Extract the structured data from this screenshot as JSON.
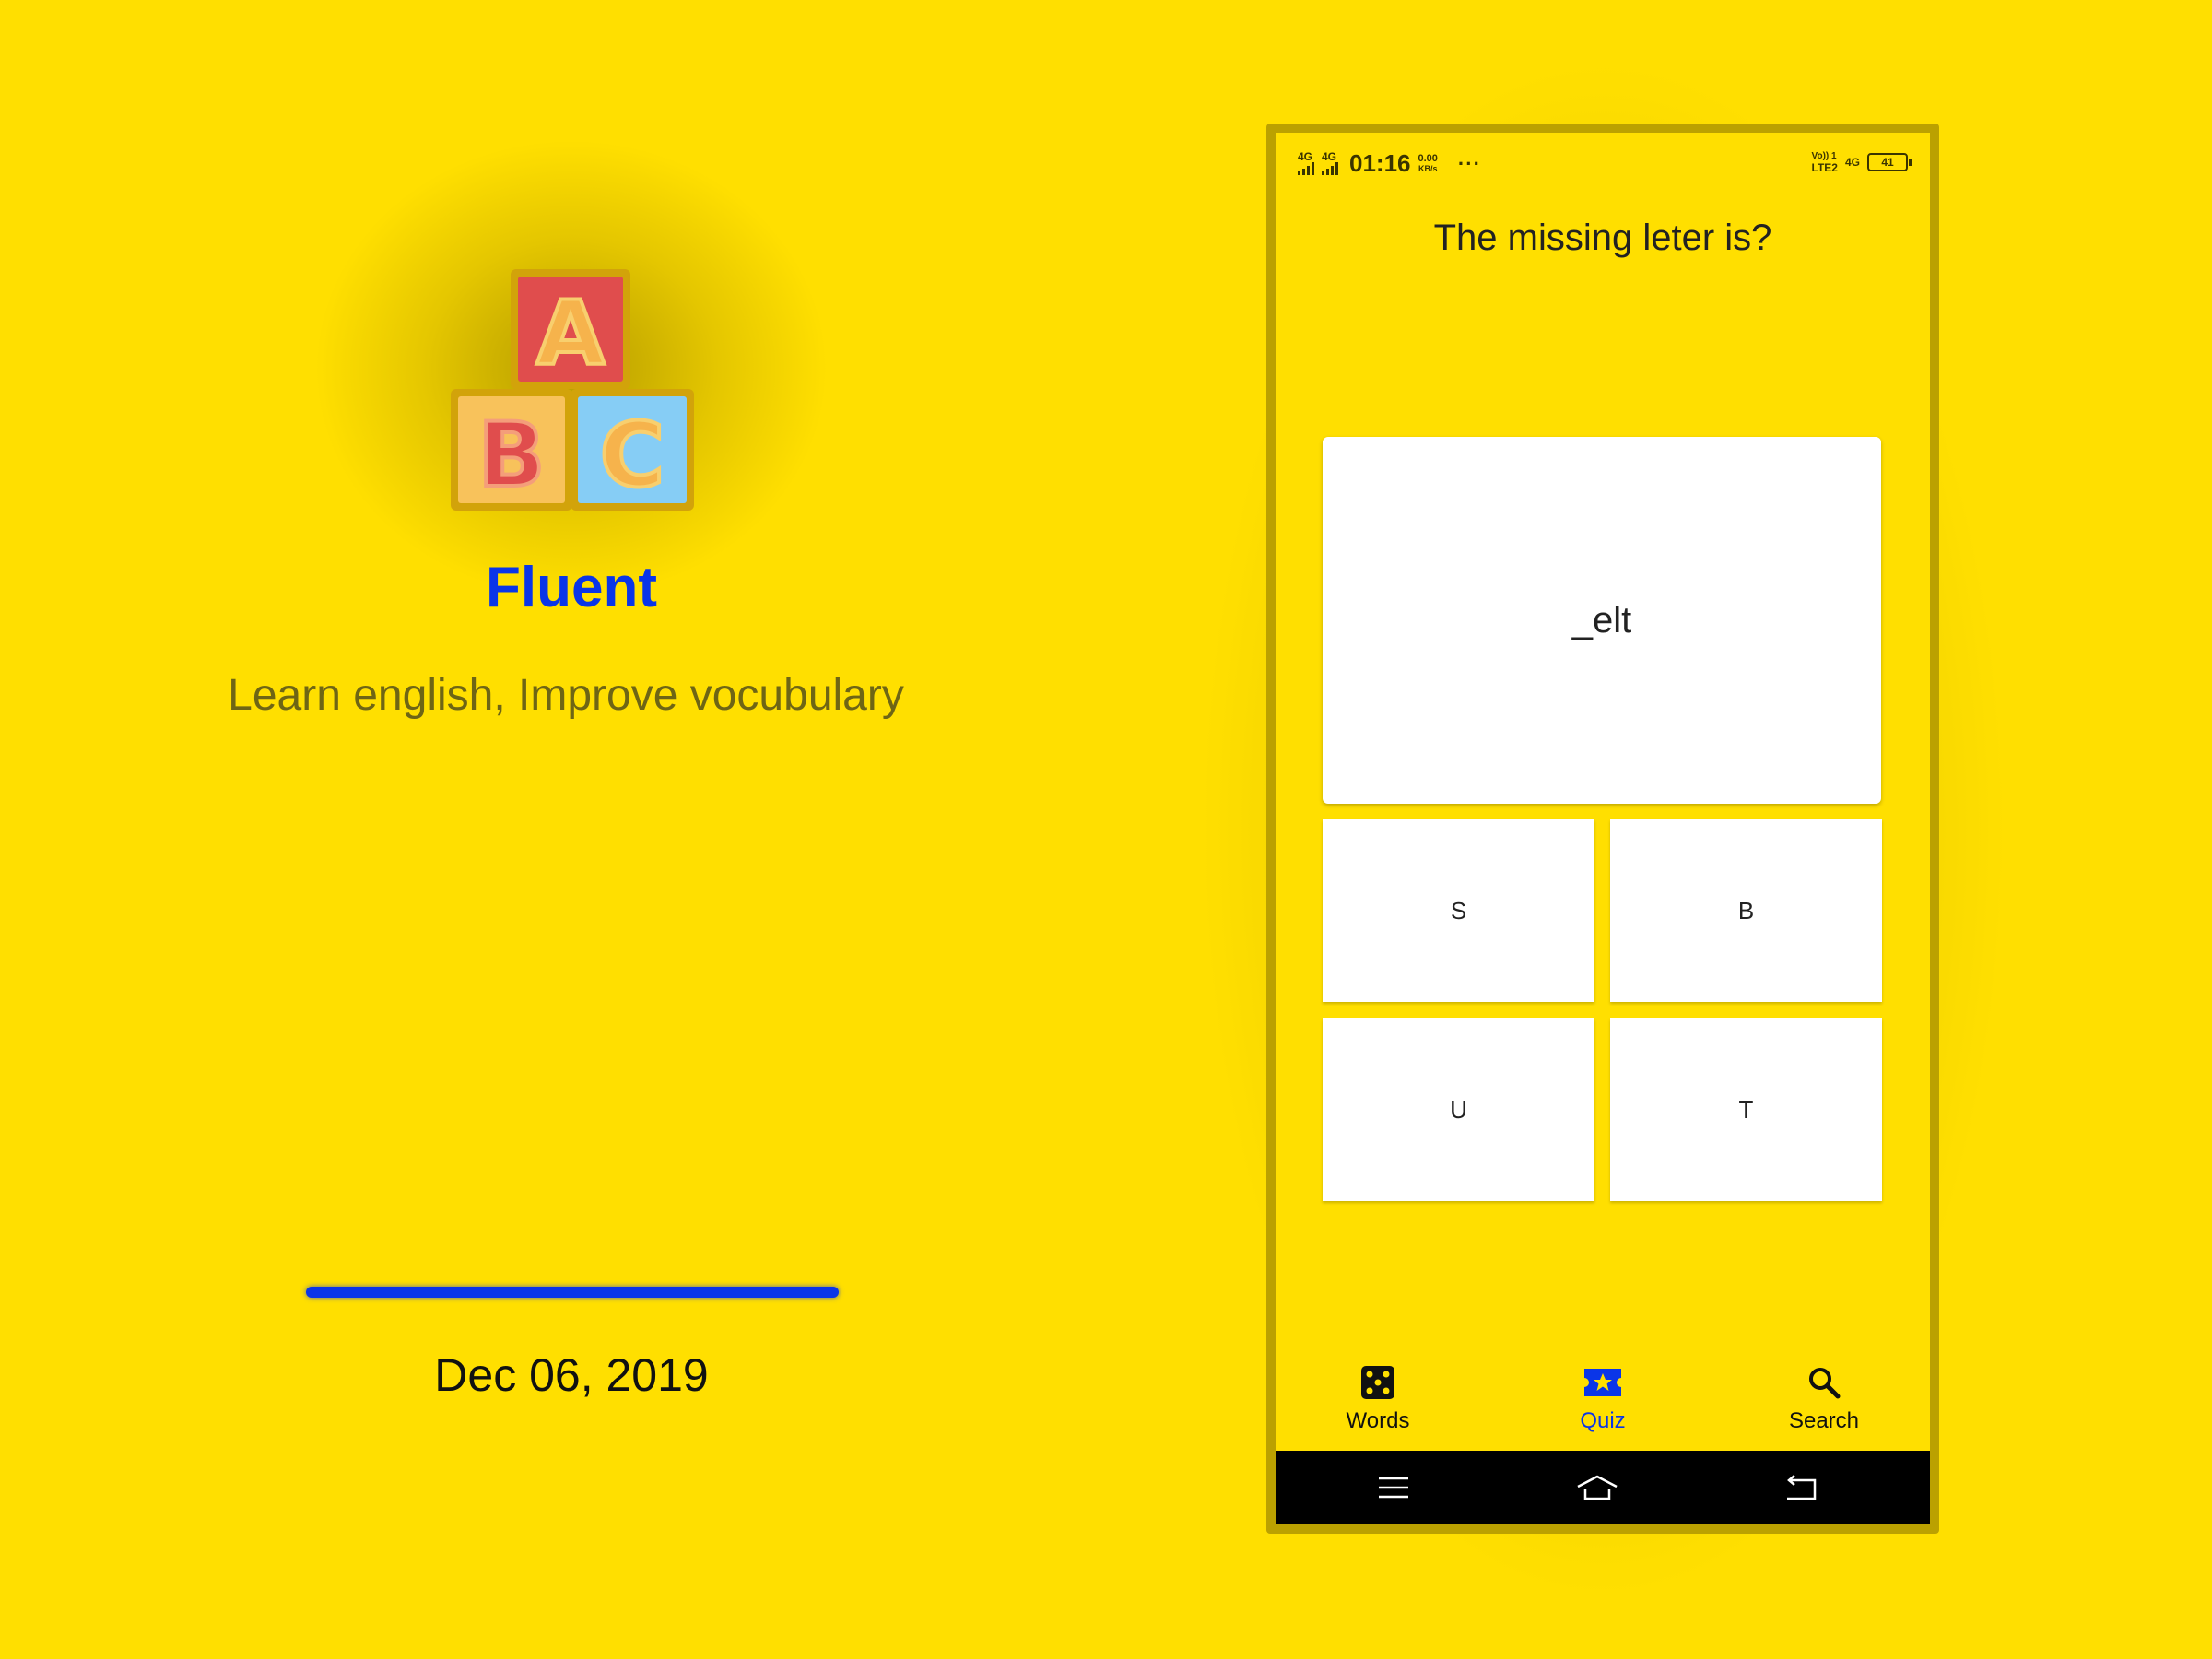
{
  "promo": {
    "app_name": "Fluent",
    "tagline": "Learn english, Improve vocubulary",
    "date": "Dec 06, 2019",
    "progress": 1.0,
    "logo_letters": [
      "A",
      "B",
      "C"
    ]
  },
  "statusbar": {
    "time": "01:16",
    "network_left": [
      "4G",
      "4G"
    ],
    "speed_value": "0.00",
    "speed_unit": "KB/s",
    "more": "···",
    "volte": "Vo)) 1",
    "lte": "LTE2",
    "network_right": "4G",
    "battery": "41"
  },
  "quiz": {
    "question": "The missing leter is?",
    "word": "_elt",
    "options": [
      "S",
      "B",
      "U",
      "T"
    ]
  },
  "bottom_nav": {
    "items": [
      {
        "label": "Words",
        "icon": "dice-icon"
      },
      {
        "label": "Quiz",
        "icon": "ticket-star-icon",
        "active": true
      },
      {
        "label": "Search",
        "icon": "search-icon"
      }
    ]
  },
  "colors": {
    "background": "#FFDF00",
    "accent": "#0A35E8",
    "tagline": "#6E6515",
    "phone_frame": "#BBA100"
  }
}
